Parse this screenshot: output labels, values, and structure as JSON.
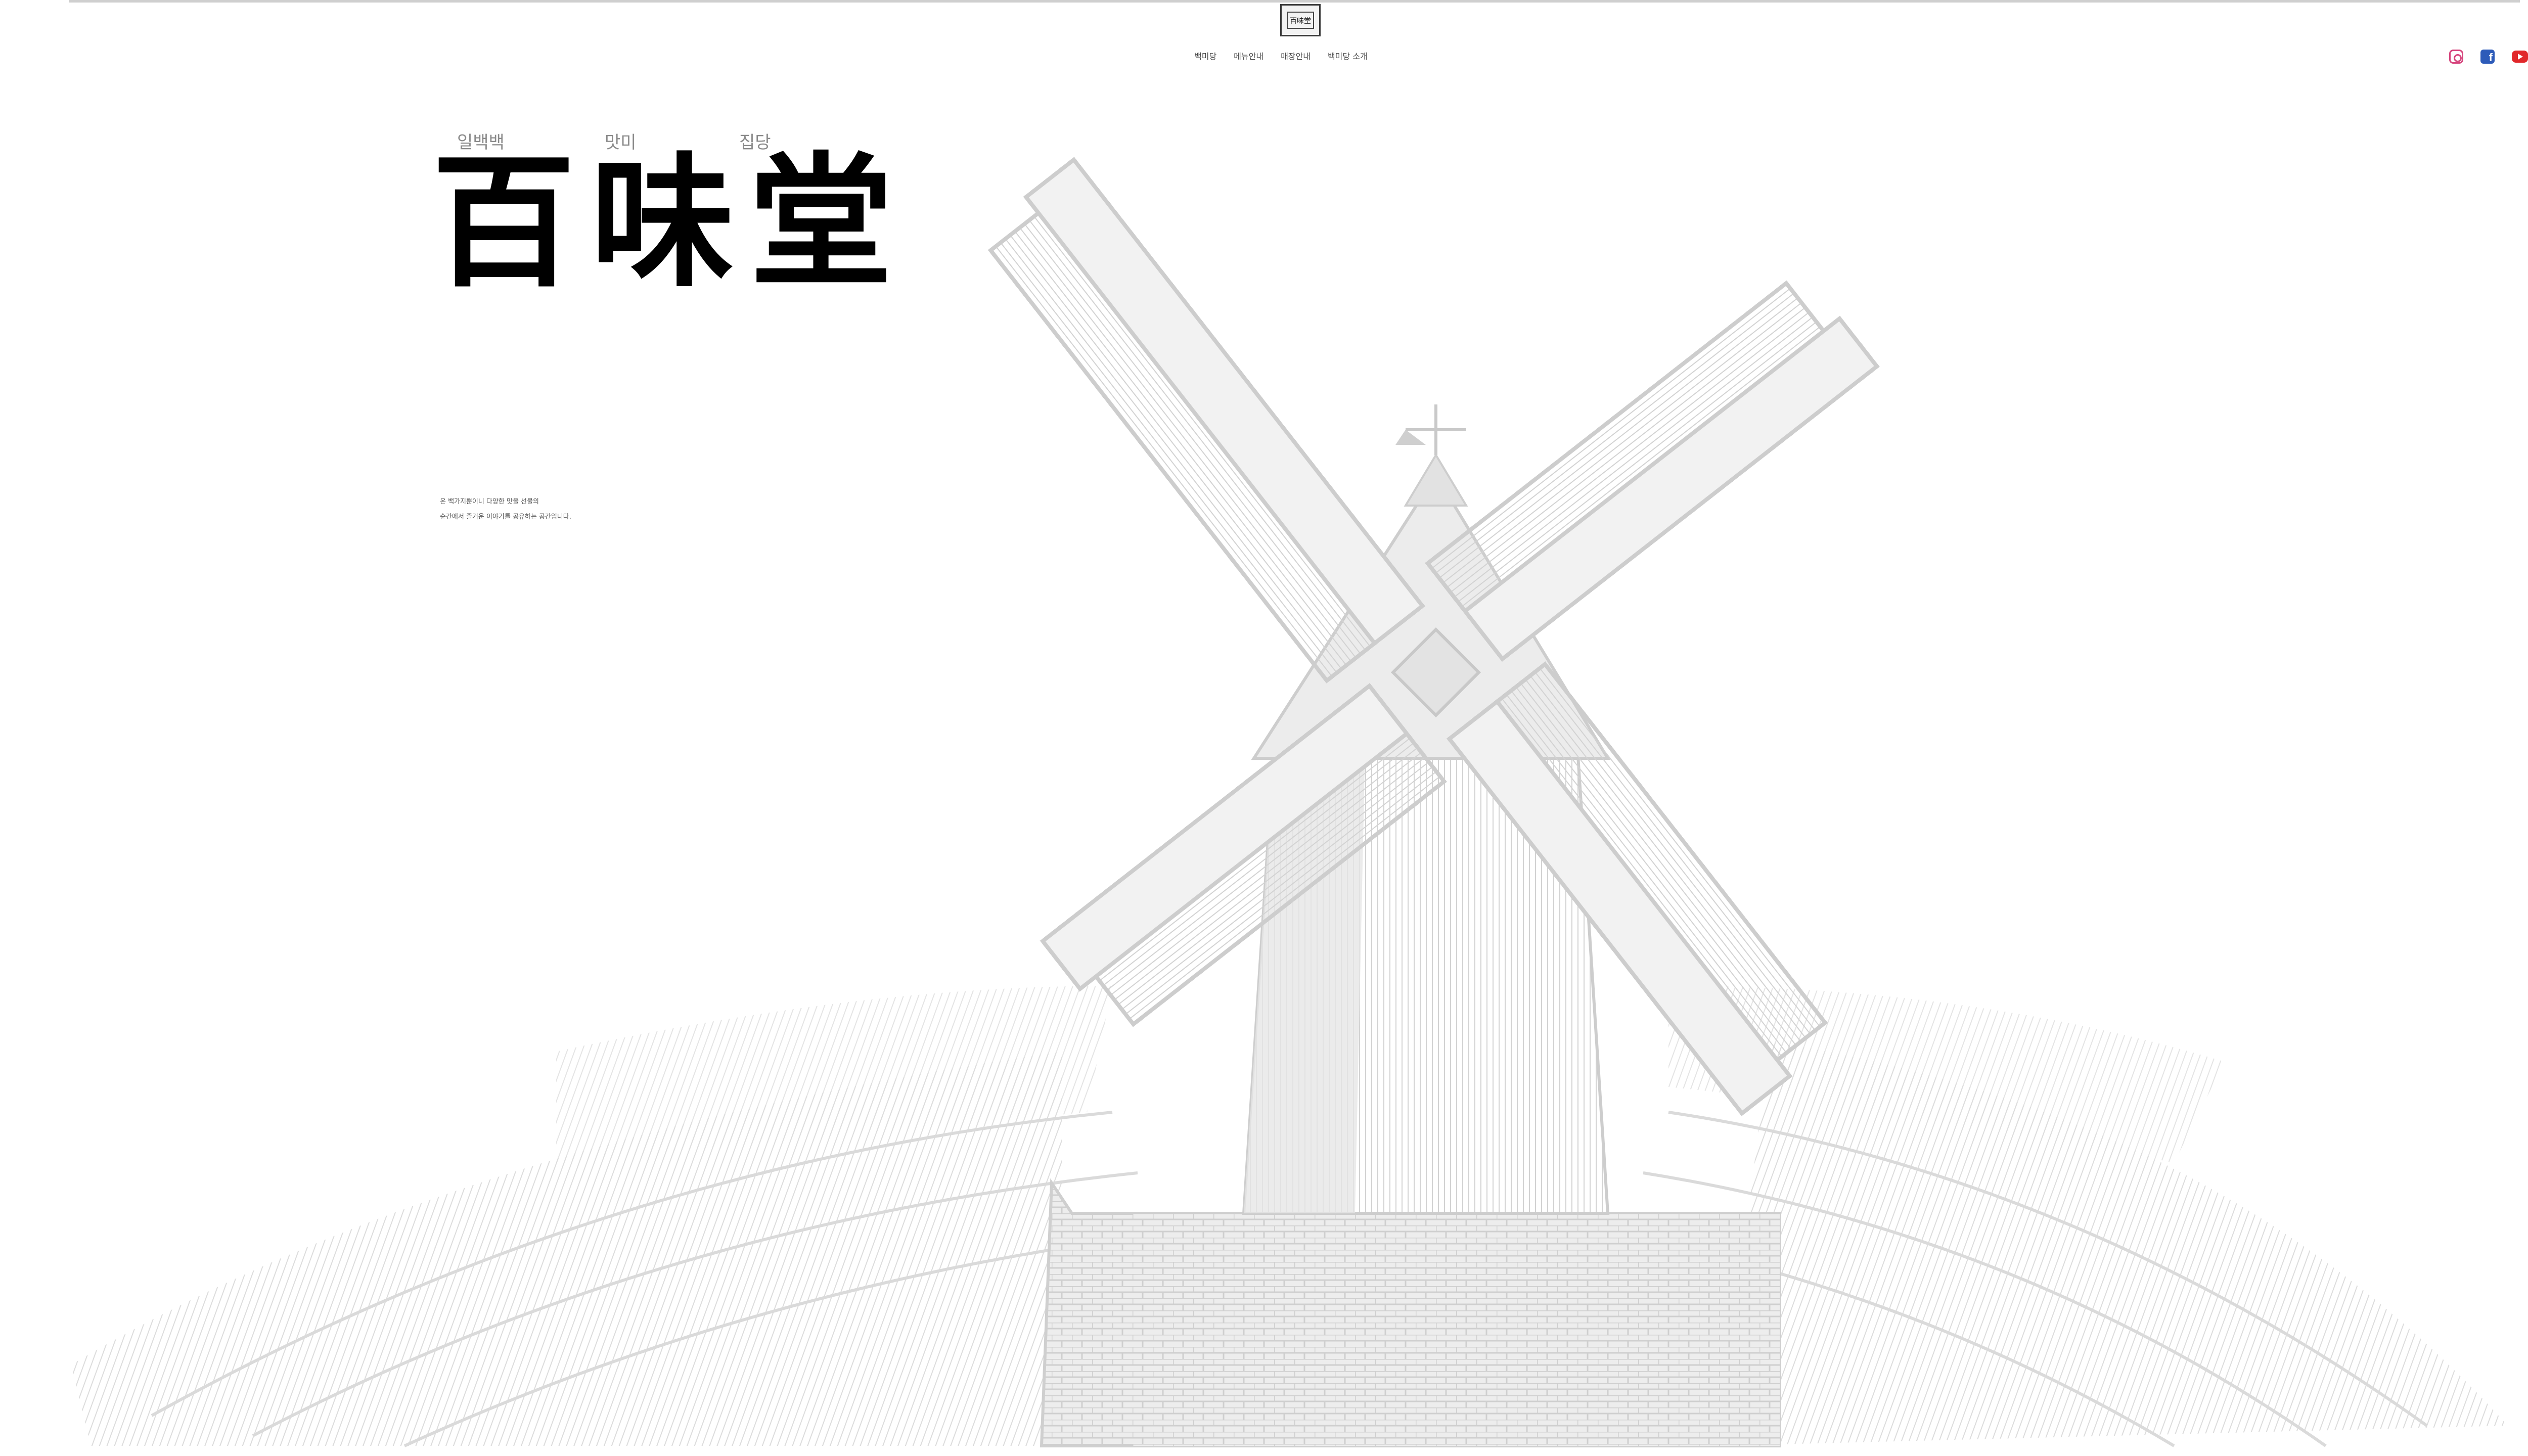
{
  "header": {
    "logo_text": "百味堂",
    "nav": [
      "백미당",
      "메뉴안내",
      "매장안내",
      "백미당 소개"
    ],
    "social": {
      "instagram": "instagram-icon",
      "facebook": "facebook-icon",
      "youtube": "youtube-icon"
    }
  },
  "hero": {
    "subtitles": [
      "일백백",
      "맛미",
      "집당"
    ],
    "title": "百味堂",
    "description": [
      "온 백가지뿐이니 다양한 맛을 선물의",
      "순간에서 즐거운 이야기를 공유하는 공간입니다."
    ]
  },
  "background": {
    "illustration": "windmill-field-sketch"
  },
  "colors": {
    "accent_instagram": "#d6457d",
    "accent_facebook": "#2d5bb9",
    "accent_youtube": "#e1272a",
    "sketch_gray": "#d4d4d4"
  }
}
